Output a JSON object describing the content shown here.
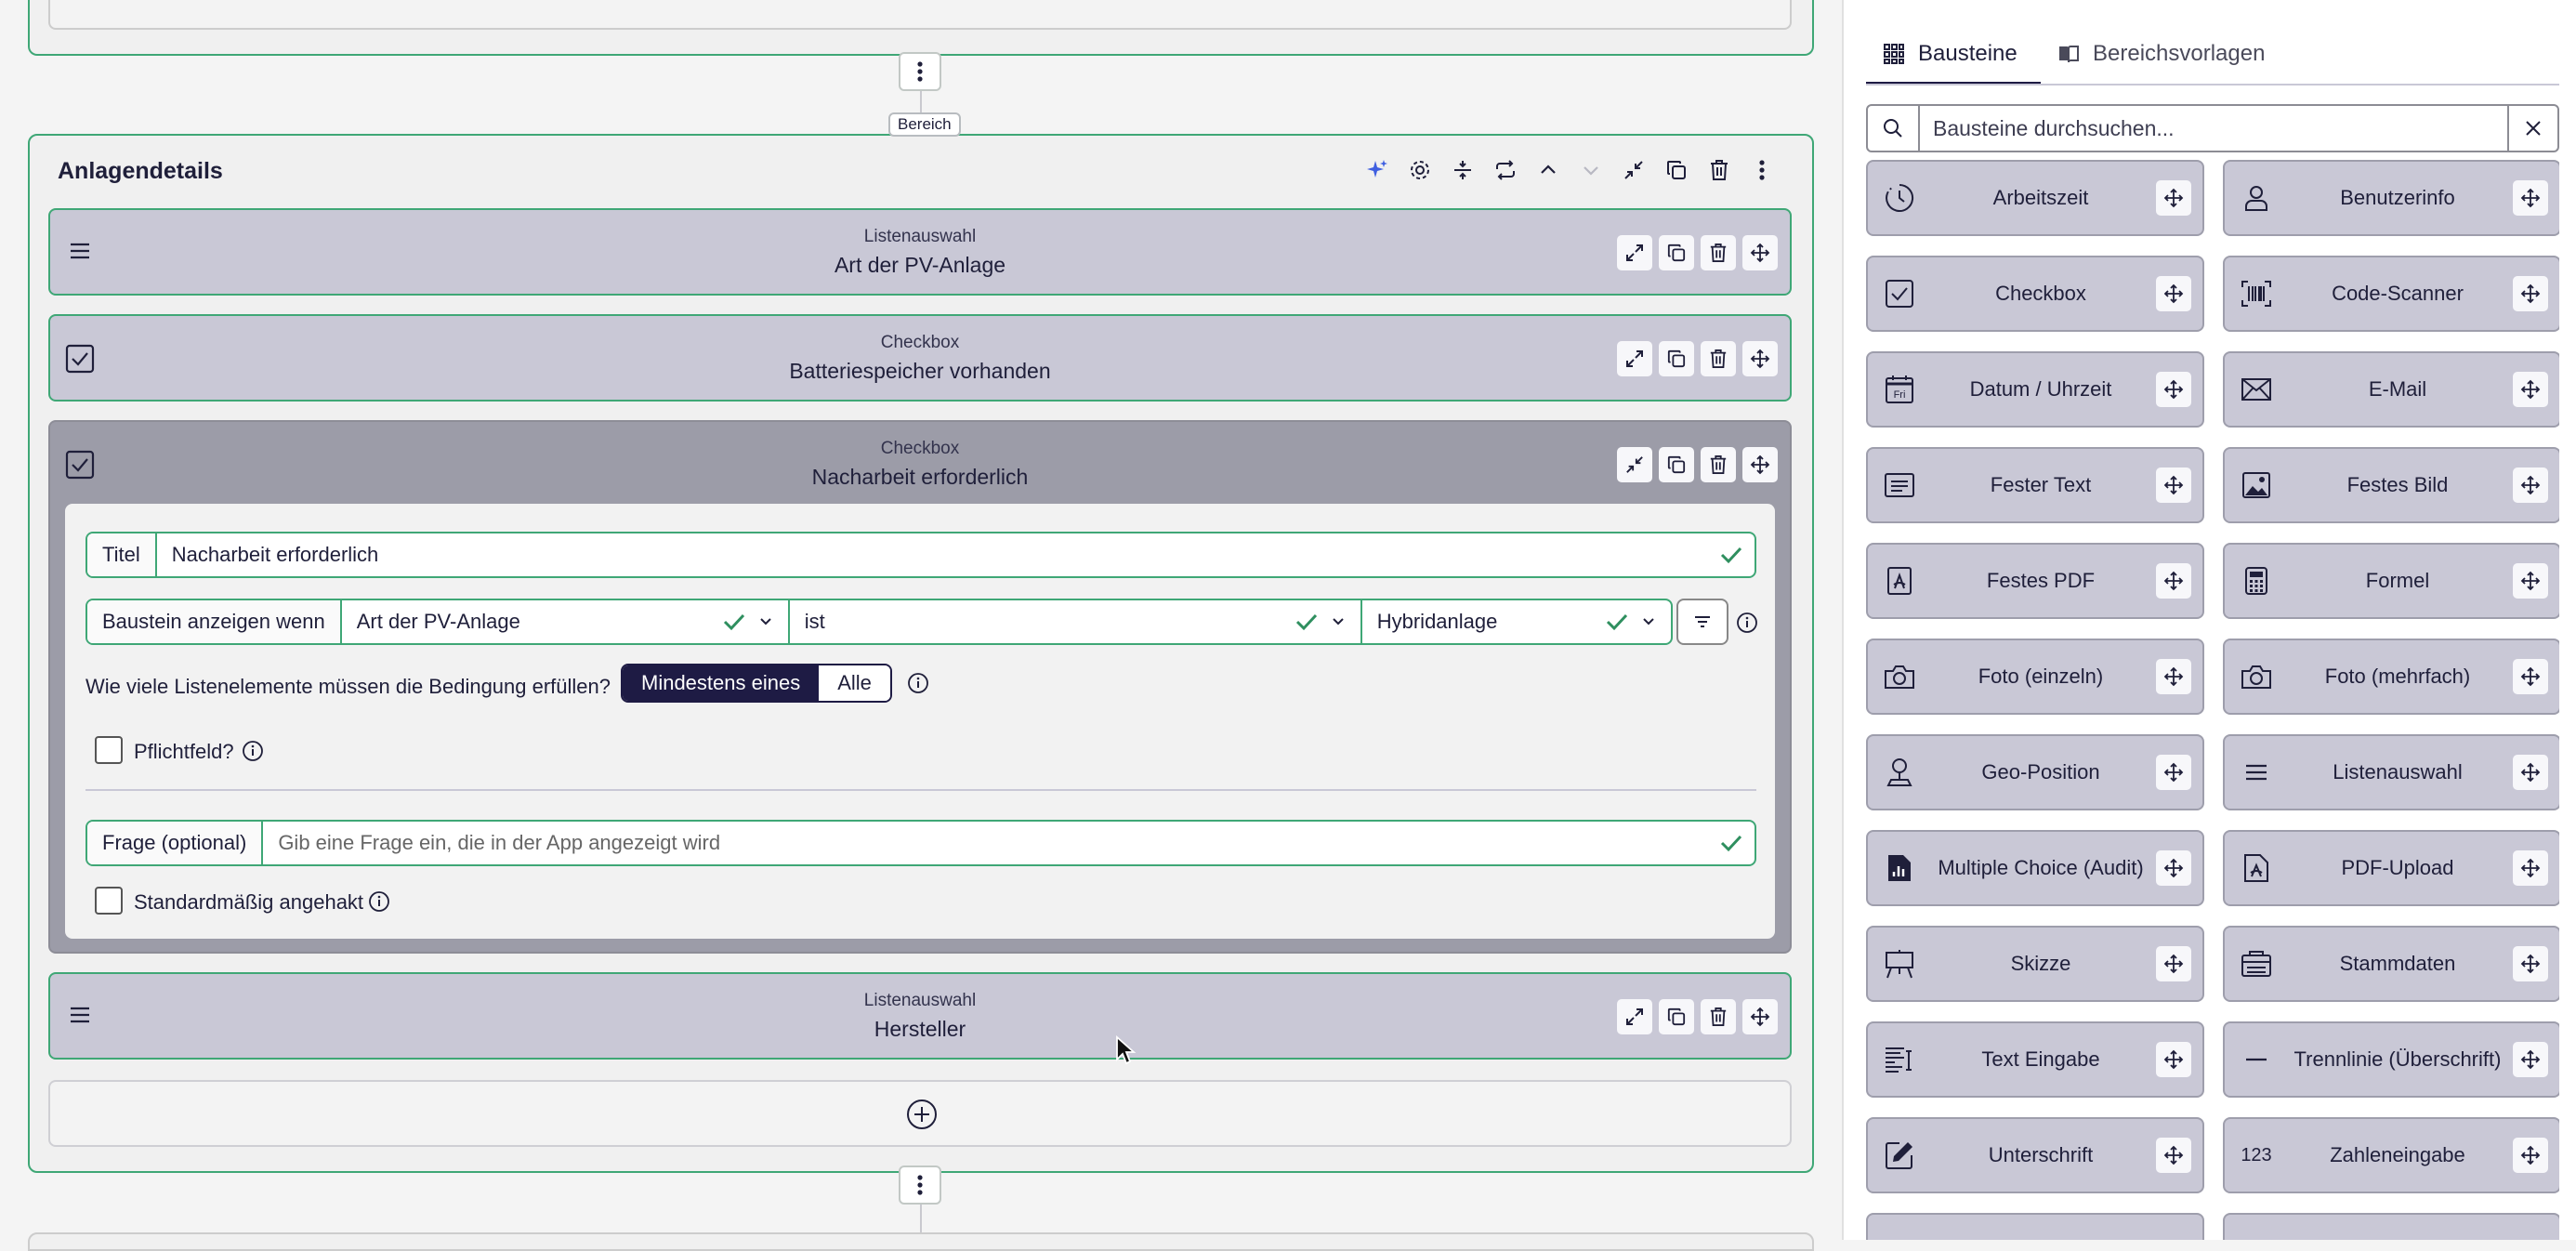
{
  "editor": {
    "section": {
      "tag": "Bereich",
      "title": "Anlagendetails"
    },
    "blocks": [
      {
        "type": "Listenauswahl",
        "name": "Art der PV-Anlage",
        "icon": "list-icon"
      },
      {
        "type": "Checkbox",
        "name": "Batteriespeicher vorhanden",
        "icon": "checkbox-icon"
      },
      {
        "type": "Checkbox",
        "name": "Nacharbeit erforderlich",
        "icon": "checkbox-icon"
      },
      {
        "type": "Listenauswahl",
        "name": "Hersteller",
        "icon": "list-icon"
      }
    ],
    "settings": {
      "title_label": "Titel",
      "title_value": "Nacharbeit erforderlich",
      "condition_label": "Baustein anzeigen wenn",
      "condition_field": "Art der PV-Anlage",
      "condition_operator": "ist",
      "condition_value": "Hybridanlage",
      "match_question": "Wie viele Listenelemente müssen die Bedingung erfüllen?",
      "match_options": [
        "Mindestens eines",
        "Alle"
      ],
      "match_selected": "Mindestens eines",
      "required_label": "Pflichtfeld?",
      "question_label": "Frage (optional)",
      "question_placeholder": "Gib eine Frage ein, die in der App angezeigt wird",
      "default_checked_label": "Standardmäßig angehakt"
    }
  },
  "panel": {
    "tabs": [
      {
        "label": "Bausteine",
        "icon": "grid-icon",
        "active": true
      },
      {
        "label": "Bereichsvorlagen",
        "icon": "book-icon",
        "active": false
      }
    ],
    "search_placeholder": "Bausteine durchsuchen...",
    "tiles": [
      {
        "label": "Arbeitszeit",
        "icon": "clock-icon"
      },
      {
        "label": "Benutzerinfo",
        "icon": "user-icon"
      },
      {
        "label": "Checkbox",
        "icon": "checkbox-icon"
      },
      {
        "label": "Code-Scanner",
        "icon": "barcode-icon"
      },
      {
        "label": "Datum / Uhrzeit",
        "icon": "calendar-icon",
        "icon_text": "Fri"
      },
      {
        "label": "E-Mail",
        "icon": "mail-icon"
      },
      {
        "label": "Fester Text",
        "icon": "text-block-icon"
      },
      {
        "label": "Festes Bild",
        "icon": "image-icon"
      },
      {
        "label": "Festes PDF",
        "icon": "pdf-icon"
      },
      {
        "label": "Formel",
        "icon": "calculator-icon"
      },
      {
        "label": "Foto (einzeln)",
        "icon": "camera-icon"
      },
      {
        "label": "Foto (mehrfach)",
        "icon": "camera-icon"
      },
      {
        "label": "Geo-Position",
        "icon": "map-pin-icon"
      },
      {
        "label": "Listenauswahl",
        "icon": "list-icon"
      },
      {
        "label": "Multiple Choice (Audit)",
        "icon": "chart-doc-icon"
      },
      {
        "label": "PDF-Upload",
        "icon": "pdf-upload-icon"
      },
      {
        "label": "Skizze",
        "icon": "easel-icon"
      },
      {
        "label": "Stammdaten",
        "icon": "database-icon"
      },
      {
        "label": "Text Eingabe",
        "icon": "text-input-icon"
      },
      {
        "label": "Trennlinie (Überschrift)",
        "icon": "divider-icon"
      },
      {
        "label": "Unterschrift",
        "icon": "signature-icon"
      },
      {
        "label": "Zahleneingabe",
        "icon": "number-icon",
        "icon_text": "123"
      }
    ]
  },
  "colors": {
    "accent_green": "#3fa776",
    "block_bg": "#c9c8d6",
    "dark_navy": "#1e1b44",
    "sparkle_blue": "#3f5fe0"
  }
}
